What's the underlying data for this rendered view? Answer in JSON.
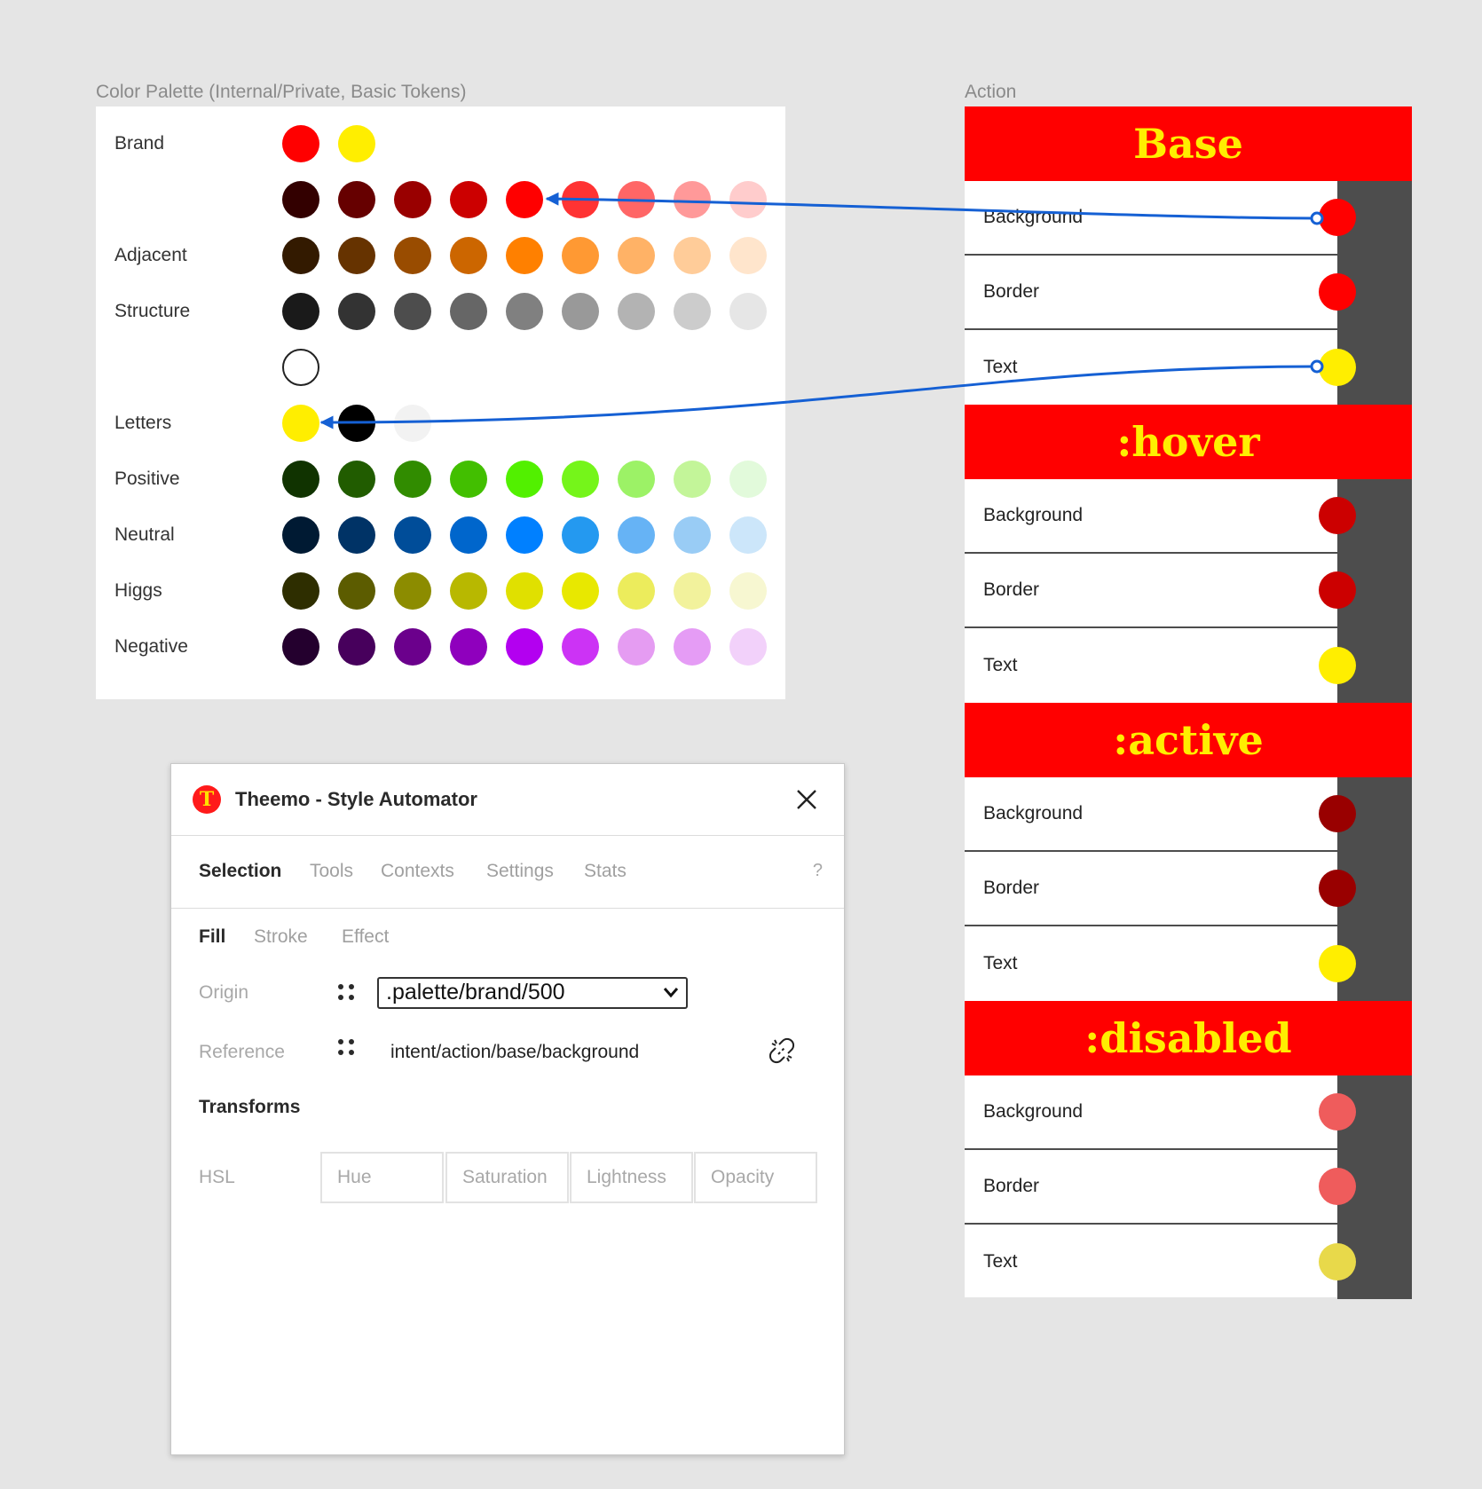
{
  "palette": {
    "title": "Color Palette (Internal/Private, Basic Tokens)",
    "rows": [
      {
        "label": "Brand",
        "colors": [
          "#ff0000",
          "#ffee00"
        ]
      },
      {
        "label": "",
        "colors": [
          "#330000",
          "#660000",
          "#990000",
          "#cc0000",
          "#ff0000",
          "#ff3333",
          "#ff6666",
          "#ff9999",
          "#ffcccc"
        ]
      },
      {
        "label": "Adjacent",
        "colors": [
          "#331a00",
          "#663300",
          "#994c00",
          "#cc6600",
          "#ff8000",
          "#ff9933",
          "#ffb266",
          "#ffcc99",
          "#ffe5cc"
        ]
      },
      {
        "label": "Structure",
        "colors": [
          "#1a1a1a",
          "#333333",
          "#4d4d4d",
          "#666666",
          "#808080",
          "#999999",
          "#b3b3b3",
          "#cccccc",
          "#e6e6e6"
        ]
      },
      {
        "label": "",
        "colors": [
          "#ffffff"
        ]
      },
      {
        "label": "Letters",
        "colors": [
          "#ffee00",
          "#000000",
          "#f2f2f2"
        ]
      },
      {
        "label": "Positive",
        "colors": [
          "#103300",
          "#215c00",
          "#318c00",
          "#42bf00",
          "#52f000",
          "#75f51a",
          "#9cf266",
          "#c3f599",
          "#e2fadb"
        ]
      },
      {
        "label": "Neutral",
        "colors": [
          "#001a33",
          "#003366",
          "#004d99",
          "#0066cc",
          "#0080ff",
          "#2499f0",
          "#66b3f5",
          "#99ccf5",
          "#cce6fa"
        ]
      },
      {
        "label": "Higgs",
        "colors": [
          "#2e2e00",
          "#5c5c00",
          "#8c8c00",
          "#b8b800",
          "#e0e000",
          "#e8e800",
          "#ecec5c",
          "#f2f29c",
          "#f7f7d1"
        ]
      },
      {
        "label": "Negative",
        "colors": [
          "#24002e",
          "#47005c",
          "#6b008c",
          "#8f00bd",
          "#b300f0",
          "#cc33f5",
          "#e59cf2",
          "#e59cf5",
          "#f2d1fa"
        ]
      }
    ]
  },
  "action": {
    "title": "Action",
    "states": [
      {
        "name": "Base",
        "rows": [
          {
            "label": "Background",
            "color": "#ff0000"
          },
          {
            "label": "Border",
            "color": "#ff0000"
          },
          {
            "label": "Text",
            "color": "#ffee00"
          }
        ]
      },
      {
        "name": ":hover",
        "rows": [
          {
            "label": "Background",
            "color": "#cc0000"
          },
          {
            "label": "Border",
            "color": "#cc0000"
          },
          {
            "label": "Text",
            "color": "#ffee00"
          }
        ]
      },
      {
        "name": ":active",
        "rows": [
          {
            "label": "Background",
            "color": "#990000"
          },
          {
            "label": "Border",
            "color": "#990000"
          },
          {
            "label": "Text",
            "color": "#ffee00"
          }
        ]
      },
      {
        "name": ":disabled",
        "rows": [
          {
            "label": "Background",
            "color": "#ef5c5c"
          },
          {
            "label": "Border",
            "color": "#ef5c5c"
          },
          {
            "label": "Text",
            "color": "#e8d94a"
          }
        ]
      }
    ]
  },
  "arrows": {
    "color": "#1560d4"
  },
  "plugin": {
    "logo_letter": "T",
    "title": "Theemo - Style Automator",
    "close_icon": "close-icon",
    "tabs": [
      "Selection",
      "Tools",
      "Contexts",
      "Settings",
      "Stats"
    ],
    "active_tab": "Selection",
    "help": "?",
    "subtabs": [
      "Fill",
      "Stroke",
      "Effect"
    ],
    "active_subtab": "Fill",
    "origin_label": "Origin",
    "origin_value": ".palette/brand/500",
    "reference_label": "Reference",
    "reference_value": "intent/action/base/background",
    "unlink_icon": "unlink-icon",
    "transforms_title": "Transforms",
    "hsl_label": "HSL",
    "hsl_placeholders": [
      "Hue",
      "Saturation",
      "Lightness",
      "Opacity"
    ]
  }
}
